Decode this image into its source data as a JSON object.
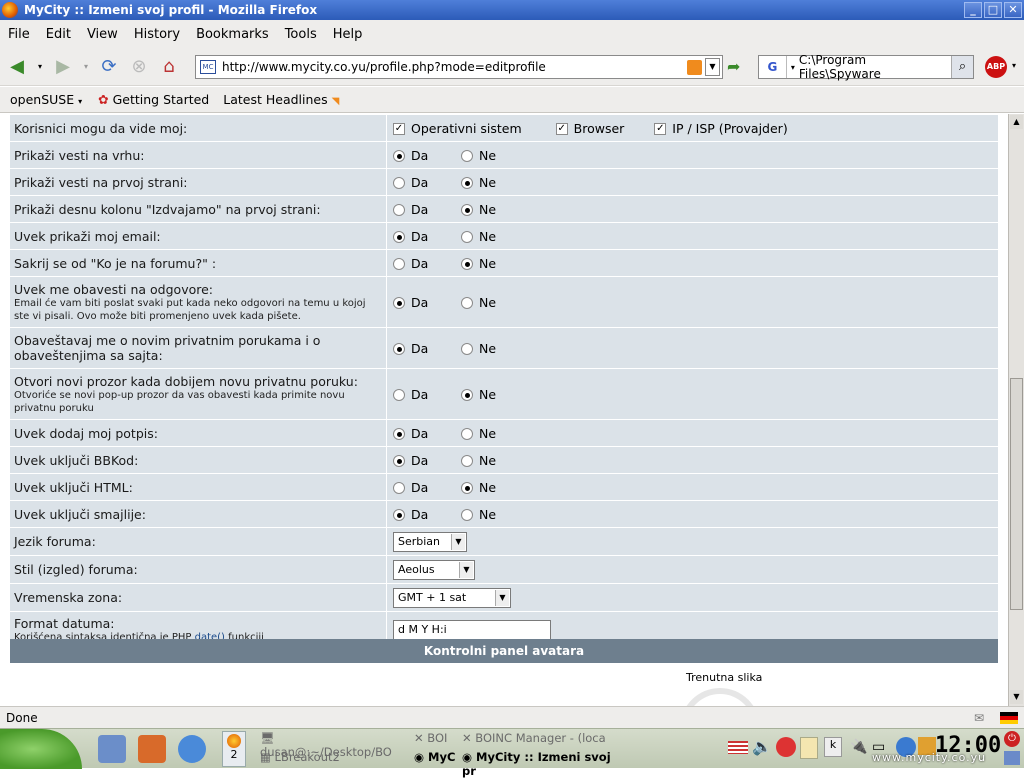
{
  "window": {
    "title": "MyCity :: Izmeni svoj profil - Mozilla Firefox"
  },
  "menu": [
    "File",
    "Edit",
    "View",
    "History",
    "Bookmarks",
    "Tools",
    "Help"
  ],
  "nav": {
    "url": "http://www.mycity.co.yu/profile.php?mode=editprofile",
    "favicon": "MC",
    "search_engine": "G",
    "search_value": "C:\\Program Files\\Spyware",
    "abp": "ABP"
  },
  "bookmarks": [
    "openSUSE",
    "Getting Started",
    "Latest Headlines"
  ],
  "form": {
    "visible_to": {
      "label": "Korisnici mogu da vide moj:",
      "options": [
        "Operativni sistem",
        "Browser",
        "IP / ISP (Provajder)"
      ]
    },
    "rows": [
      {
        "label": "Prikaži vesti na vrhu:",
        "sub": "",
        "selected": "Da"
      },
      {
        "label": "Prikaži vesti na prvoj strani:",
        "sub": "",
        "selected": "Ne"
      },
      {
        "label": "Prikaži desnu kolonu \"Izdvajamo\" na prvoj strani:",
        "sub": "",
        "selected": "Ne"
      },
      {
        "label": "Uvek prikaži moj email:",
        "sub": "",
        "selected": "Da"
      },
      {
        "label": "Sakrij se od \"Ko je na forumu?\" :",
        "sub": "",
        "selected": "Ne"
      },
      {
        "label": "Uvek me obavesti na odgovore:",
        "sub": "Email će vam biti poslat svaki put kada neko odgovori na temu u kojoj ste vi pisali. Ovo može biti promenjeno uvek kada pišete.",
        "selected": "Da"
      },
      {
        "label": "Obaveštavaj me o novim privatnim porukama i o obaveštenjima sa sajta:",
        "sub": "",
        "selected": "Da"
      },
      {
        "label": "Otvori novi prozor kada dobijem novu privatnu poruku:",
        "sub": "Otvoriće se novi pop-up prozor da vas obavesti kada primite novu privatnu poruku",
        "selected": "Ne"
      },
      {
        "label": "Uvek dodaj moj potpis:",
        "sub": "",
        "selected": "Da"
      },
      {
        "label": "Uvek uključi BBKod:",
        "sub": "",
        "selected": "Da"
      },
      {
        "label": "Uvek uključi HTML:",
        "sub": "",
        "selected": "Ne"
      },
      {
        "label": "Uvek uključi smajlije:",
        "sub": "",
        "selected": "Da"
      }
    ],
    "yes": "Da",
    "no": "Ne",
    "language": {
      "label": "Jezik foruma:",
      "value": "Serbian"
    },
    "style": {
      "label": "Stil (izgled) foruma:",
      "value": "Aeolus"
    },
    "timezone": {
      "label": "Vremenska zona:",
      "value": "GMT + 1 sat"
    },
    "dateformat": {
      "label": "Format datuma:",
      "sub_before": "Korišćena sintaksa identična je PHP ",
      "sub_link": "date()",
      "sub_after": " funkciji",
      "value": "d M Y H:i"
    }
  },
  "avatar": {
    "title": "Kontrolni panel avatara",
    "current": "Trenutna slika"
  },
  "status": "Done",
  "taskbar": {
    "desk_number": "2",
    "tasks": [
      "dusan@:~/Desktop/BO",
      "BOI",
      "BOINC Manager - (loca",
      "LBreakout2",
      "MyC",
      "MyCity :: Izmeni svoj pr"
    ],
    "clock": "12:00",
    "watermark": "www.mycity.co.yu"
  }
}
